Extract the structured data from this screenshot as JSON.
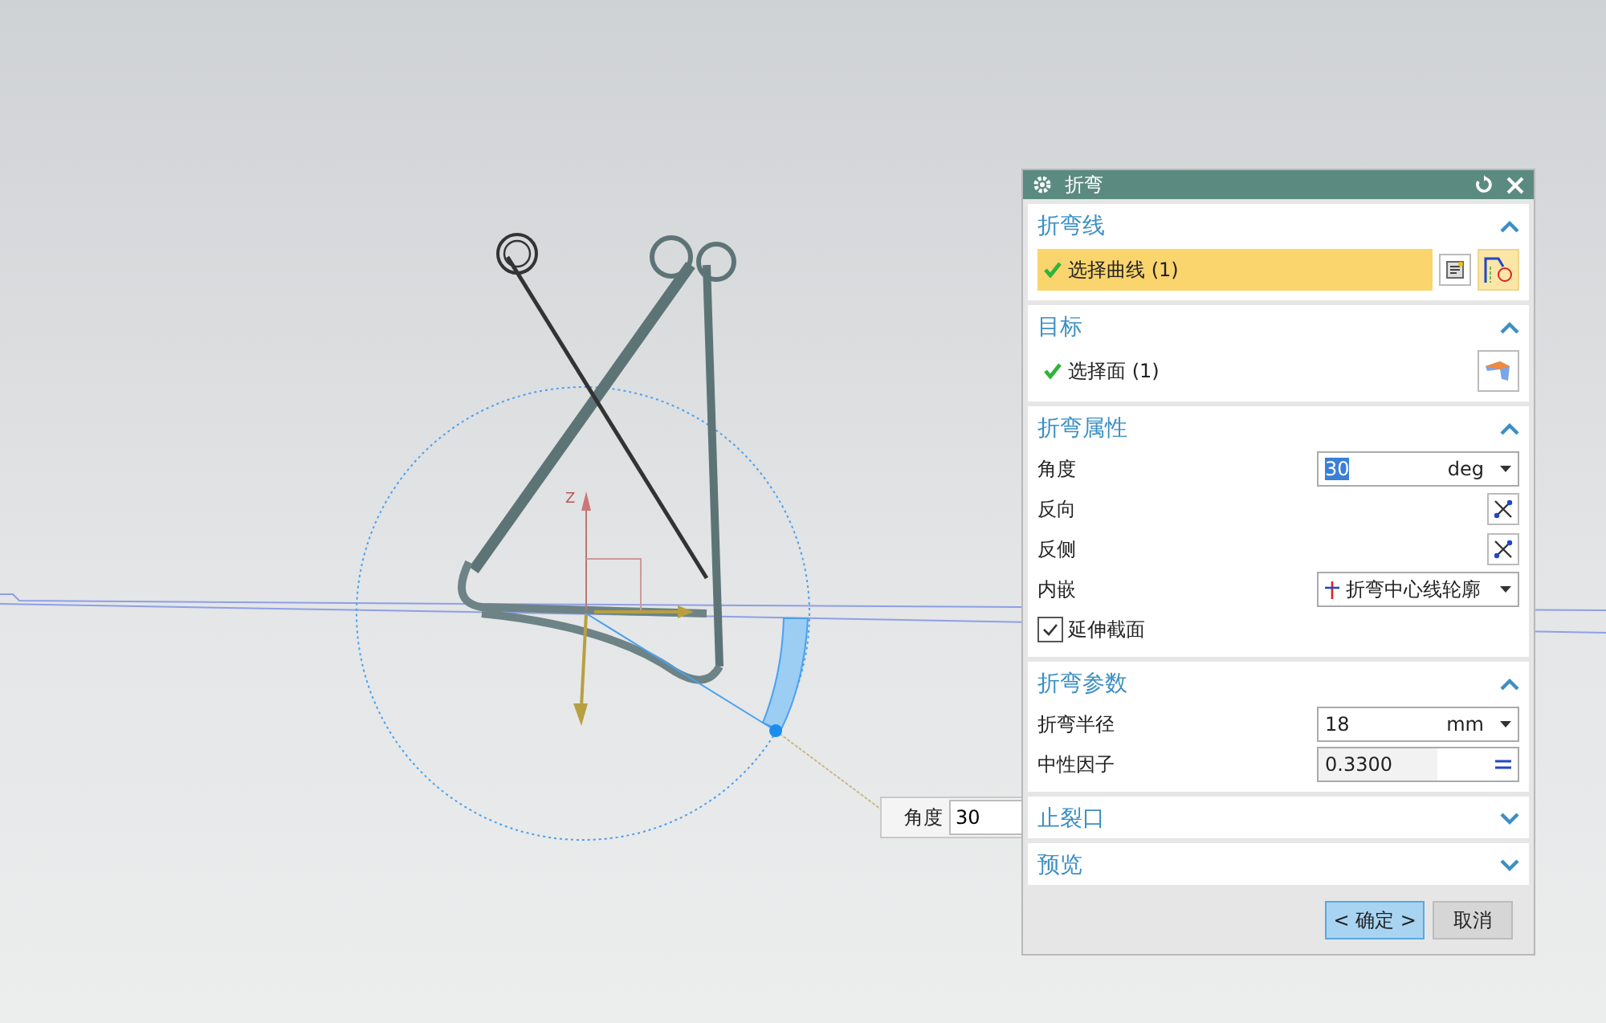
{
  "viewport": {
    "axis_label": "Z",
    "angle_input": {
      "label": "角度",
      "value": "30"
    }
  },
  "dialog": {
    "title": "折弯",
    "sections": [
      {
        "title": "折弯线",
        "expanded": true,
        "rows": [
          {
            "kind": "curve_select",
            "label": "选择曲线 (1)",
            "checked": true,
            "selected": true
          }
        ]
      },
      {
        "title": "目标",
        "expanded": true,
        "rows": [
          {
            "kind": "face_select",
            "label": "选择面 (1)",
            "checked": true,
            "selected": false
          }
        ]
      },
      {
        "title": "折弯属性",
        "expanded": true,
        "rows": [
          {
            "kind": "value",
            "label": "角度",
            "value": "30",
            "unit": "deg",
            "text_selected": true
          },
          {
            "kind": "toggle",
            "label": "反向"
          },
          {
            "kind": "toggle",
            "label": "反侧"
          },
          {
            "kind": "dropdown",
            "label": "内嵌",
            "value": "折弯中心线轮廓"
          },
          {
            "kind": "checkbox",
            "label": "延伸截面",
            "checked": true
          }
        ]
      },
      {
        "title": "折弯参数",
        "expanded": true,
        "rows": [
          {
            "kind": "value",
            "label": "折弯半径",
            "value": "18",
            "unit": "mm",
            "text_selected": false
          },
          {
            "kind": "formula",
            "label": "中性因子",
            "value": "0.3300"
          }
        ]
      },
      {
        "title": "止裂口",
        "expanded": false
      },
      {
        "title": "预览",
        "expanded": false
      }
    ],
    "buttons": [
      {
        "label": "< 确定 >",
        "kind": "primary"
      },
      {
        "label": "取消",
        "kind": "secondary"
      }
    ]
  }
}
